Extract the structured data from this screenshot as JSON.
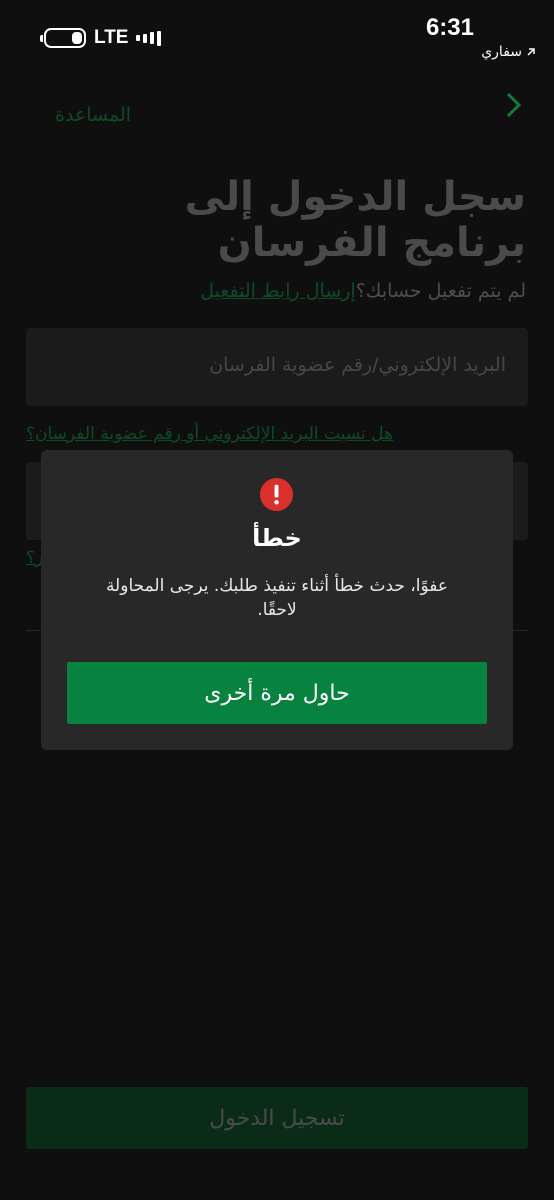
{
  "status_bar": {
    "network": "LTE",
    "battery_level": 0.3,
    "time": "6:31",
    "back_app_label": "سفاري"
  },
  "header": {
    "help_label": "المساعدة",
    "back_icon": "chevron-right-icon"
  },
  "login": {
    "title_line1": "سجل الدخول إلى",
    "title_line2": "برنامج الفرسان",
    "activation_question": "لم يتم تفعيل حسابك؟",
    "activation_link": "إرسال رابط التفعيل",
    "email_placeholder": "البريد الإلكتروني/رقم عضوية الفرسان",
    "forgot_email_link": "هل نسيت البريد الإلكتروني أو رقم عضوية الفرسان؟",
    "forgot_password_link_visible": "ر؟",
    "login_button": "تسجيل الدخول"
  },
  "modal": {
    "icon": "error-exclamation-icon",
    "title": "خطأ",
    "message": "عفوًا، حدث خطأ أثناء تنفيذ طلبك. يرجى المحاولة لاحقًا.",
    "retry_button": "حاول مرة أخرى"
  },
  "colors": {
    "accent_green": "#07823f",
    "error_red": "#d9302c",
    "modal_bg": "#282828"
  }
}
